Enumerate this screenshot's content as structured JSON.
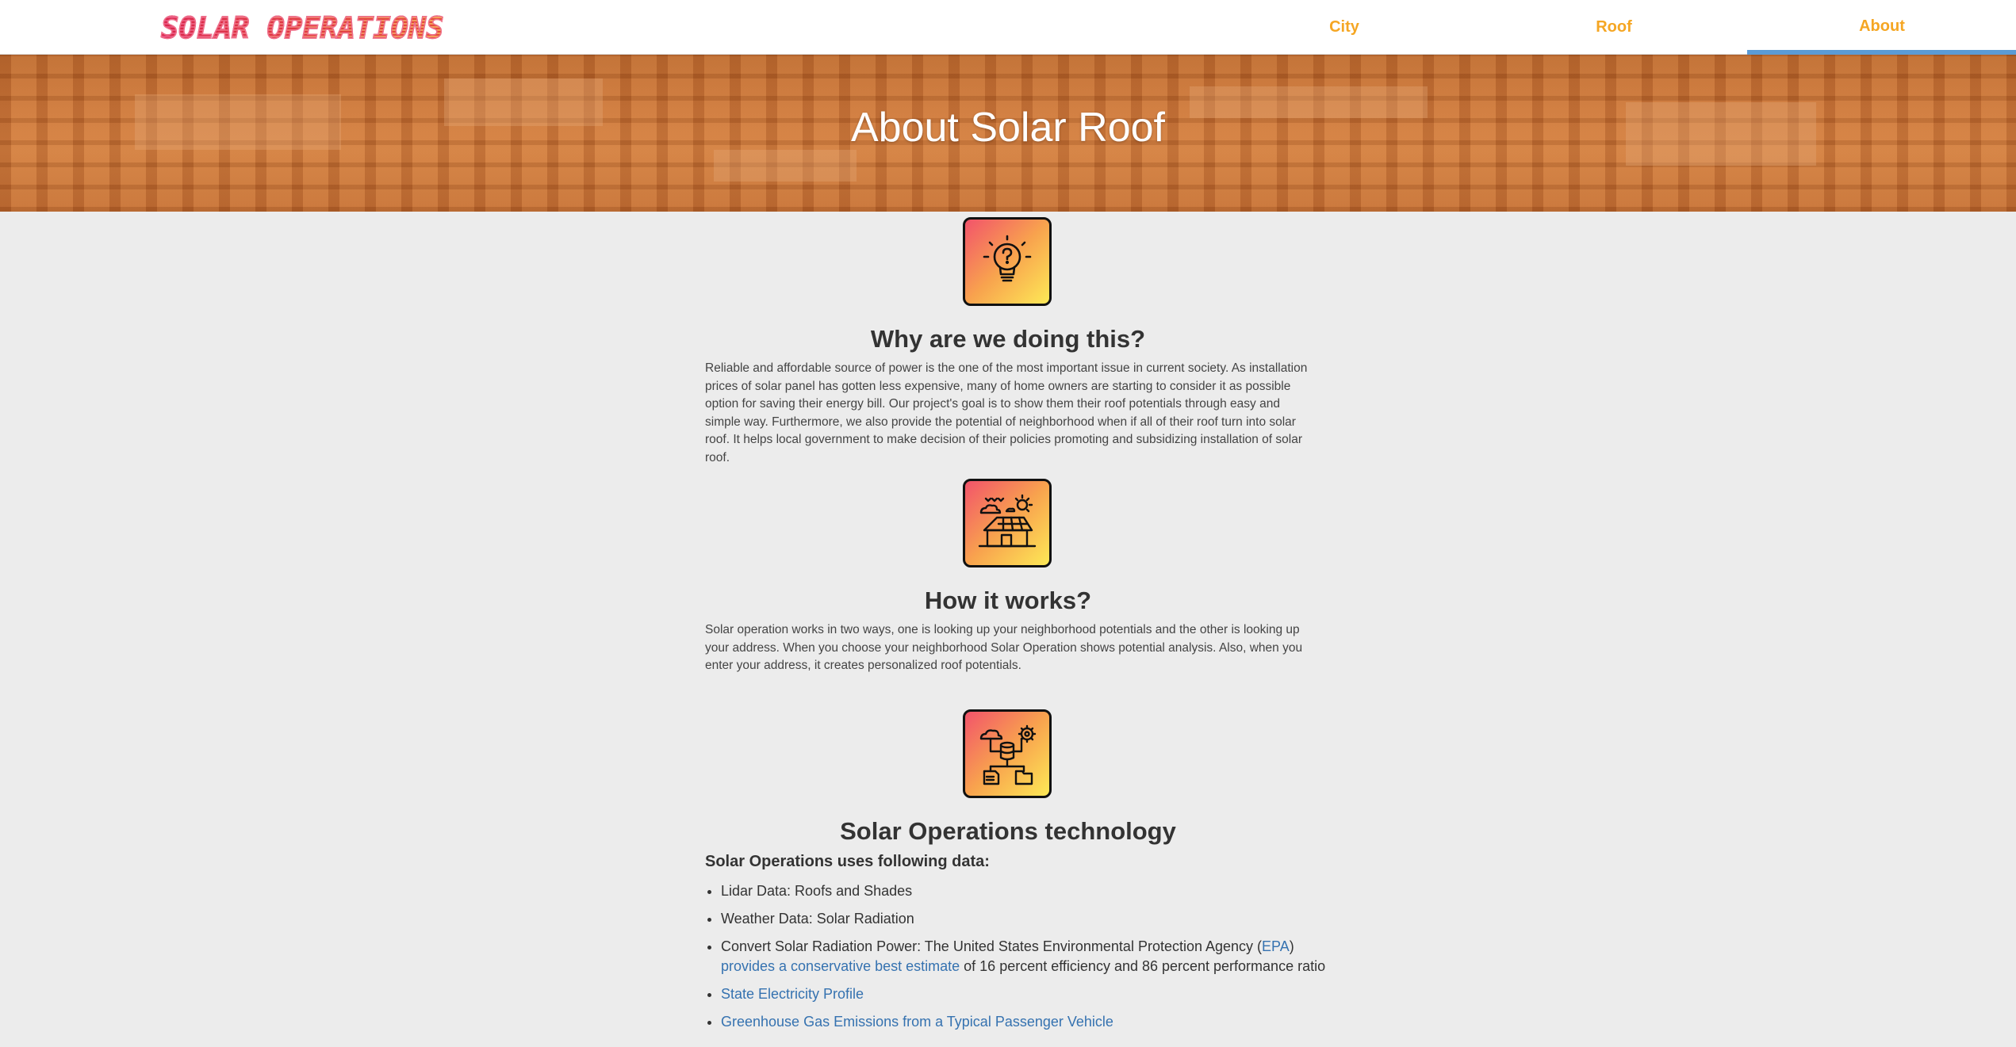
{
  "nav": {
    "brand": "SOLAR OPERATIONS",
    "items": [
      {
        "label": "City",
        "active": false
      },
      {
        "label": "Roof",
        "active": false
      },
      {
        "label": "About",
        "active": true
      }
    ],
    "text_color": "#f5a623",
    "active_indicator_color": "#5b9bd5"
  },
  "hero": {
    "title": "About Solar Roof"
  },
  "sections": {
    "why": {
      "icon": "lightbulb-question-icon",
      "heading": "Why are we doing this?",
      "body": "Reliable and affordable source of power is the one of the most important issue in current society. As installation prices of solar panel has gotten less expensive, many of home owners are starting to consider it as possible option for saving their energy bill. Our project's goal is to show them their roof potentials through easy and simple way. Furthermore, we also provide the potential of neighborhood when if all of their roof turn into solar roof. It helps local government to make decision of their policies promoting and subsidizing installation of solar roof."
    },
    "how": {
      "icon": "solar-house-icon",
      "heading": "How it works?",
      "body": "Solar operation works in two ways, one is looking up your neighborhood potentials and the other is looking up your address. When you choose your neighborhood Solar Operation shows potential analysis. Also, when you enter your address, it creates personalized roof potentials."
    },
    "tech": {
      "icon": "data-network-icon",
      "heading": "Solar Operations technology",
      "subheading": "Solar Operations uses following data:",
      "items": {
        "lidar": "Lidar Data: Roofs and Shades",
        "weather": "Weather Data: Solar Radiation",
        "convert_prefix": "Convert Solar Radiation Power: The United States Environmental Protection Agency (",
        "convert_epa_link": "EPA",
        "convert_mid": ")",
        "convert_estimate_link": "provides a conservative best estimate",
        "convert_suffix": " of 16 percent efficiency and 86 percent performance ratio",
        "state_profile_link": "State Electricity Profile",
        "ghg_link": "Greenhouse Gas Emissions from a Typical Passenger Vehicle"
      }
    }
  },
  "colors": {
    "page_bg": "#ececec",
    "link": "#3572b0",
    "icon_gradient": [
      "#f2536b",
      "#f8a24e",
      "#fde956"
    ]
  }
}
